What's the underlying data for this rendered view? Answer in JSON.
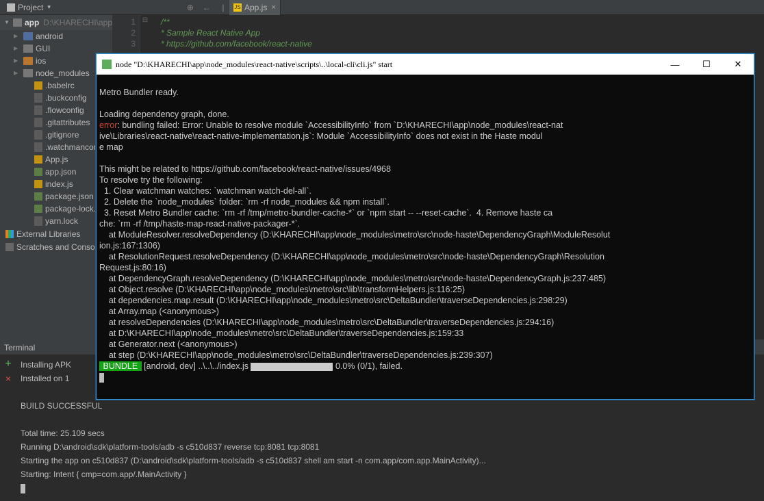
{
  "toolbar": {
    "project_label": "Project",
    "icons": [
      "⊕",
      "←",
      "↔",
      "✶",
      "⌄"
    ]
  },
  "editor_tab": {
    "name": "App.js",
    "close": "×"
  },
  "tree": {
    "root": {
      "name": "app",
      "path": "D:\\KHARECHI\\app"
    },
    "items": [
      {
        "depth": 1,
        "arrow": "right",
        "icon": "folder",
        "label": "android"
      },
      {
        "depth": 1,
        "arrow": "right",
        "icon": "folder grey",
        "label": "GUI"
      },
      {
        "depth": 1,
        "arrow": "right",
        "icon": "folder orange",
        "label": "ios"
      },
      {
        "depth": 1,
        "arrow": "right",
        "icon": "folder grey",
        "label": "node_modules"
      },
      {
        "depth": 2,
        "arrow": "none",
        "icon": "js",
        "label": ".babelrc"
      },
      {
        "depth": 2,
        "arrow": "none",
        "icon": "file",
        "label": ".buckconfig"
      },
      {
        "depth": 2,
        "arrow": "none",
        "icon": "file",
        "label": ".flowconfig"
      },
      {
        "depth": 2,
        "arrow": "none",
        "icon": "file",
        "label": ".gitattributes"
      },
      {
        "depth": 2,
        "arrow": "none",
        "icon": "file",
        "label": ".gitignore"
      },
      {
        "depth": 2,
        "arrow": "none",
        "icon": "file",
        "label": ".watchmanconfig"
      },
      {
        "depth": 2,
        "arrow": "none",
        "icon": "js",
        "label": "App.js"
      },
      {
        "depth": 2,
        "arrow": "none",
        "icon": "json",
        "label": "app.json"
      },
      {
        "depth": 2,
        "arrow": "none",
        "icon": "js",
        "label": "index.js"
      },
      {
        "depth": 2,
        "arrow": "none",
        "icon": "json",
        "label": "package.json"
      },
      {
        "depth": 2,
        "arrow": "none",
        "icon": "json",
        "label": "package-lock.json"
      },
      {
        "depth": 2,
        "arrow": "none",
        "icon": "file",
        "label": "yarn.lock"
      }
    ],
    "ext_libs": "External Libraries",
    "scratches": "Scratches and Consoles"
  },
  "code": {
    "l1": "/**",
    "l2": " * Sample React Native App",
    "l3": " * https://github.com/facebook/react-native"
  },
  "terminal": {
    "title": "Terminal",
    "lines": {
      "t1": "Installing APK",
      "t2": "Installed on 1",
      "t3": "",
      "t4": "BUILD SUCCESSFUL",
      "t5": "",
      "t6": "Total time: 25.109 secs",
      "t7": "Running D:\\android\\sdk\\platform-tools/adb -s c510d837 reverse tcp:8081 tcp:8081",
      "t8": "Starting the app on c510d837 (D:\\android\\sdk\\platform-tools/adb -s c510d837 shell am start -n com.app/com.app.MainActivity)...",
      "t9": "Starting: Intent { cmp=com.app/.MainActivity }"
    }
  },
  "nodewin": {
    "title": "node  \"D:\\KHARECHI\\app\\node_modules\\react-native\\scripts\\..\\local-cli\\cli.js\" start",
    "min": "—",
    "max": "☐",
    "close": "✕",
    "lines": {
      "n1": "Metro Bundler ready.",
      "n2": "",
      "n3": "Loading dependency graph, done.",
      "n4a": "error",
      "n4b": ": bundling failed: Error: Unable to resolve module `AccessibilityInfo` from `D:\\KHARECHI\\app\\node_modules\\react-nat",
      "n5": "ive\\Libraries\\react-native\\react-native-implementation.js`: Module `AccessibilityInfo` does not exist in the Haste modul",
      "n6": "e map",
      "n7": "",
      "n8": "This might be related to https://github.com/facebook/react-native/issues/4968",
      "n9": "To resolve try the following:",
      "n10": "  1. Clear watchman watches: `watchman watch-del-all`.",
      "n11": "  2. Delete the `node_modules` folder: `rm -rf node_modules && npm install`.",
      "n12": "  3. Reset Metro Bundler cache: `rm -rf /tmp/metro-bundler-cache-*` or `npm start -- --reset-cache`.  4. Remove haste ca",
      "n13": "che: `rm -rf /tmp/haste-map-react-native-packager-*`.",
      "n14": "    at ModuleResolver.resolveDependency (D:\\KHARECHI\\app\\node_modules\\metro\\src\\node-haste\\DependencyGraph\\ModuleResolut",
      "n15": "ion.js:167:1306)",
      "n16": "    at ResolutionRequest.resolveDependency (D:\\KHARECHI\\app\\node_modules\\metro\\src\\node-haste\\DependencyGraph\\Resolution",
      "n17": "Request.js:80:16)",
      "n18": "    at DependencyGraph.resolveDependency (D:\\KHARECHI\\app\\node_modules\\metro\\src\\node-haste\\DependencyGraph.js:237:485)",
      "n19": "    at Object.resolve (D:\\KHARECHI\\app\\node_modules\\metro\\src\\lib\\transformHelpers.js:116:25)",
      "n20": "    at dependencies.map.result (D:\\KHARECHI\\app\\node_modules\\metro\\src\\DeltaBundler\\traverseDependencies.js:298:29)",
      "n21": "    at Array.map (<anonymous>)",
      "n22": "    at resolveDependencies (D:\\KHARECHI\\app\\node_modules\\metro\\src\\DeltaBundler\\traverseDependencies.js:294:16)",
      "n23": "    at D:\\KHARECHI\\app\\node_modules\\metro\\src\\DeltaBundler\\traverseDependencies.js:159:33",
      "n24": "    at Generator.next (<anonymous>)",
      "n25": "    at step (D:\\KHARECHI\\app\\node_modules\\metro\\src\\DeltaBundler\\traverseDependencies.js:239:307)",
      "n26a": " BUNDLE ",
      "n26b": " [android, dev] ..\\..\\../index.js ",
      "n26c": " 0.0% (0/1), failed."
    }
  }
}
